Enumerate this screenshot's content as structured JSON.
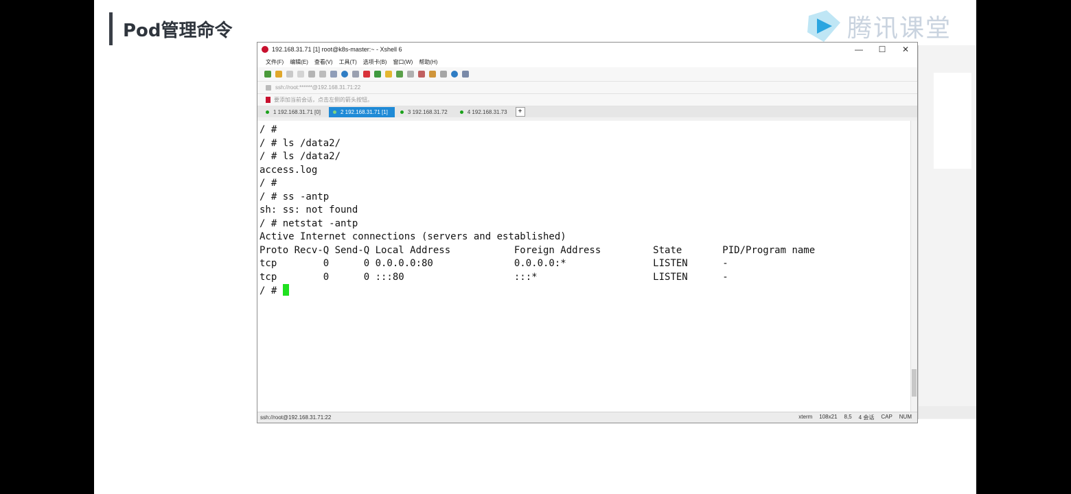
{
  "slide": {
    "title": "Pod管理命令",
    "logo_text": "腾讯课堂"
  },
  "window": {
    "title": "192.168.31.71 [1]   root@k8s-master:~  - Xshell 6",
    "controls": [
      "—",
      "☐",
      "✕"
    ]
  },
  "menu": [
    "文件(F)",
    "编辑(E)",
    "查看(V)",
    "工具(T)",
    "选项卡(B)",
    "窗口(W)",
    "帮助(H)"
  ],
  "address": "ssh://root:******@192.168.31.71:22",
  "linkbar": "要添加当前会话，点击左侧的箭头按钮。",
  "tabs": [
    {
      "label": "1 192.168.31.71 [0]",
      "active": false
    },
    {
      "label": "2 192.168.31.71 [1]",
      "active": true
    },
    {
      "label": "3 192.168.31.72",
      "active": false
    },
    {
      "label": "4 192.168.31.73",
      "active": false
    }
  ],
  "terminal": {
    "lines": [
      "/ #",
      "/ # ls /data2/",
      "/ # ls /data2/",
      "access.log",
      "/ #",
      "/ # ss -antp",
      "sh: ss: not found",
      "/ # netstat -antp",
      "Active Internet connections (servers and established)",
      "Proto Recv-Q Send-Q Local Address           Foreign Address         State       PID/Program name",
      "tcp        0      0 0.0.0.0:80              0.0.0.0:*               LISTEN      -",
      "tcp        0      0 :::80                   :::*                    LISTEN      -"
    ],
    "prompt": "/ # "
  },
  "status": {
    "left": "ssh://root@192.168.31.71:22",
    "term": "xterm",
    "size": "108x21",
    "pos": "8,5",
    "sessions": "4 会话",
    "caps": "CAP",
    "num": "NUM"
  },
  "colors": {
    "active_tab": "#1f8ad6",
    "cursor": "#1fe01f",
    "brand_red": "#c8102e"
  }
}
